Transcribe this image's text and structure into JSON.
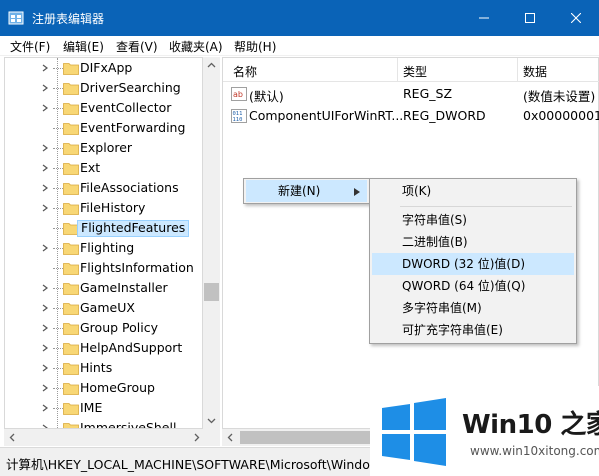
{
  "window": {
    "title": "注册表编辑器"
  },
  "menu": [
    "文件(F)",
    "编辑(E)",
    "查看(V)",
    "收藏夹(A)",
    "帮助(H)"
  ],
  "tree": {
    "items": [
      {
        "label": "DIFxApp",
        "expandable": true
      },
      {
        "label": "DriverSearching",
        "expandable": true
      },
      {
        "label": "EventCollector",
        "expandable": true
      },
      {
        "label": "EventForwarding",
        "expandable": false
      },
      {
        "label": "Explorer",
        "expandable": true
      },
      {
        "label": "Ext",
        "expandable": true
      },
      {
        "label": "FileAssociations",
        "expandable": true
      },
      {
        "label": "FileHistory",
        "expandable": true
      },
      {
        "label": "FlightedFeatures",
        "expandable": false,
        "selected": true
      },
      {
        "label": "Flighting",
        "expandable": true
      },
      {
        "label": "FlightsInformation",
        "expandable": false
      },
      {
        "label": "GameInstaller",
        "expandable": true
      },
      {
        "label": "GameUX",
        "expandable": true
      },
      {
        "label": "Group Policy",
        "expandable": true
      },
      {
        "label": "HelpAndSupport",
        "expandable": true
      },
      {
        "label": "Hints",
        "expandable": true
      },
      {
        "label": "HomeGroup",
        "expandable": true
      },
      {
        "label": "IME",
        "expandable": true
      },
      {
        "label": "ImmersiveShell",
        "expandable": true
      }
    ]
  },
  "list": {
    "headers": {
      "name": "名称",
      "type": "类型",
      "data": "数据"
    },
    "rows": [
      {
        "icon": "ab",
        "name": "(默认)",
        "type": "REG_SZ",
        "data": "(数值未设置)"
      },
      {
        "icon": "binary",
        "name": "ComponentUIForWinRT...",
        "type": "REG_DWORD",
        "data": "0x00000001"
      }
    ]
  },
  "context_menu": {
    "new_label": "新建(N)",
    "submenu": {
      "key": "项(K)",
      "items": [
        {
          "label": "字符串值(S)"
        },
        {
          "label": "二进制值(B)"
        },
        {
          "label": "DWORD (32 位)值(D)",
          "hover": true
        },
        {
          "label": "QWORD (64 位)值(Q)"
        },
        {
          "label": "多字符串值(M)"
        },
        {
          "label": "可扩充字符串值(E)"
        }
      ]
    }
  },
  "status": {
    "path": "计算机\\HKEY_LOCAL_MACHINE\\SOFTWARE\\Microsoft\\Windows"
  },
  "watermark": {
    "title": "Win10 之家",
    "url": "www.win10xitong.com"
  },
  "colors": {
    "titlebar": "#0a63b7",
    "selection": "#cce8ff",
    "folder": "#f8d775",
    "watermark_blue": "#1e8ee6"
  }
}
